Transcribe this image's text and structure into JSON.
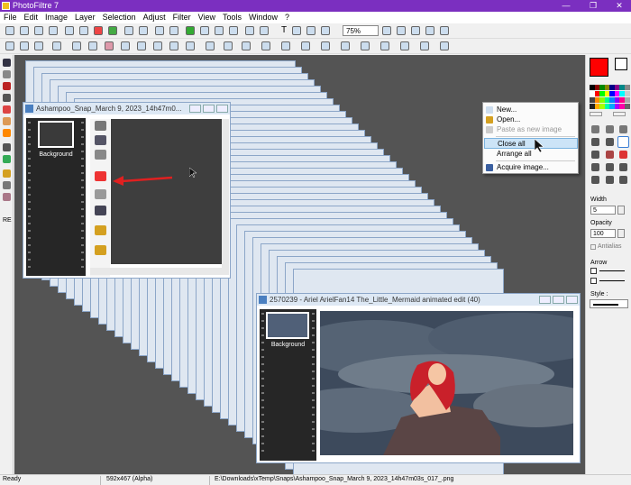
{
  "window": {
    "title": "PhotoFiltre 7",
    "controls": [
      "—",
      "❐",
      "✕"
    ]
  },
  "menu": [
    "File",
    "Edit",
    "Image",
    "Layer",
    "Selection",
    "Adjust",
    "Filter",
    "View",
    "Tools",
    "Window",
    "?"
  ],
  "toolbar": {
    "zoom_value": "75%",
    "text_tool_glyph": "T"
  },
  "left_tools": {
    "bottom_label": "RE"
  },
  "doc1": {
    "title": "Ashampoo_Snap_March 9, 2023_14h47m0...",
    "layer_label": "Background"
  },
  "doc2": {
    "title": "2570239 - Ariel ArielFan14 The_Little_Mermaid animated edit (40)",
    "layer_label": "Background"
  },
  "context_menu": {
    "items": [
      {
        "label": "New...",
        "disabled": false,
        "highlighted": false
      },
      {
        "label": "Open...",
        "disabled": false,
        "highlighted": false
      },
      {
        "label": "Paste as new image",
        "disabled": true,
        "highlighted": false
      },
      {
        "label": "Close all",
        "disabled": false,
        "highlighted": true
      },
      {
        "label": "Arrange all",
        "disabled": false,
        "highlighted": false
      },
      {
        "label": "Acquire image...",
        "disabled": false,
        "highlighted": false
      }
    ]
  },
  "right_panel": {
    "width_label": "Width",
    "width_value": "5",
    "opacity_label": "Opacity",
    "opacity_value": "100",
    "antialias_label": "Antialias",
    "arrow_label": "Arrow",
    "style_label": "Style :"
  },
  "statusbar": {
    "status": "Ready",
    "dimensions": "592x467 (Alpha)",
    "filepath": "E:\\Downloads\\xTemp\\Snaps\\Ashampoo_Snap_March 9, 2023_14h47m03s_017_.png"
  },
  "colors": {
    "titlebar": "#7b2fc0",
    "workspace": "#545454",
    "foreground_color": "#ff0000",
    "background_color": "#ffffff",
    "arrow_annotation": "#e02020",
    "highlight": "#cce4f7"
  }
}
